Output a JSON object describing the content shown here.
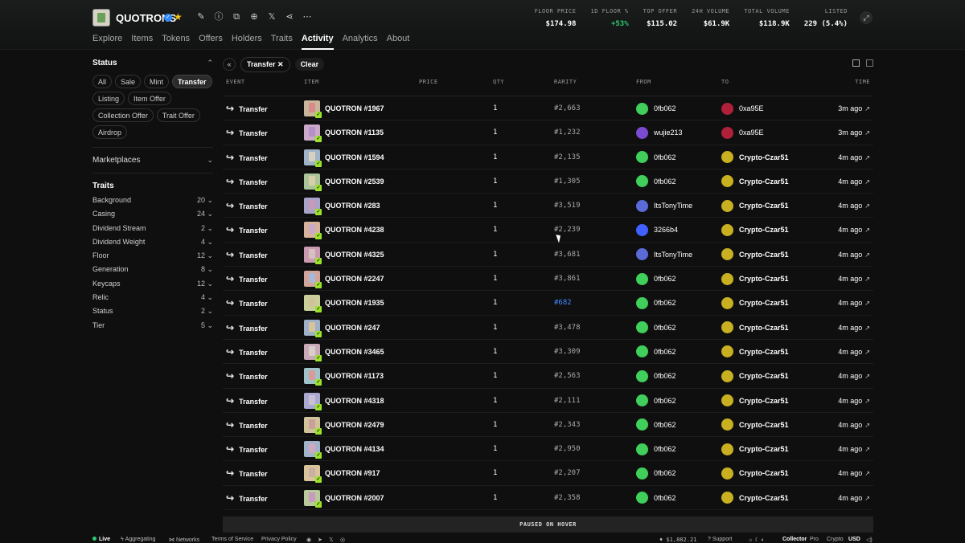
{
  "header": {
    "collection_name": "QUOTRONS",
    "icons": [
      "pencil-icon",
      "info-icon",
      "copy-icon",
      "globe-icon",
      "x-icon",
      "share-icon",
      "more-icon"
    ],
    "tabs": [
      "Explore",
      "Items",
      "Tokens",
      "Offers",
      "Holders",
      "Traits",
      "Activity",
      "Analytics",
      "About"
    ],
    "active_tab": "Activity",
    "stats": [
      {
        "label": "FLOOR PRICE",
        "value": "$174.98"
      },
      {
        "label": "1D FLOOR %",
        "value": "+53%"
      },
      {
        "label": "TOP OFFER",
        "value": "$115.02"
      },
      {
        "label": "24H VOLUME",
        "value": "$61.9K"
      },
      {
        "label": "TOTAL VOLUME",
        "value": "$118.9K"
      },
      {
        "label": "LISTED",
        "value": "229 (5.4%)"
      }
    ]
  },
  "sidebar": {
    "status_title": "Status",
    "status_chips": [
      "All",
      "Sale",
      "Mint",
      "Transfer",
      "Listing",
      "Item Offer",
      "Collection Offer",
      "Trait Offer",
      "Airdrop"
    ],
    "active_chip": "Transfer",
    "marketplaces_title": "Marketplaces",
    "traits_title": "Traits",
    "traits": [
      {
        "name": "Background",
        "count": "20"
      },
      {
        "name": "Casing",
        "count": "24"
      },
      {
        "name": "Dividend Stream",
        "count": "2"
      },
      {
        "name": "Dividend Weight",
        "count": "4"
      },
      {
        "name": "Floor",
        "count": "12"
      },
      {
        "name": "Generation",
        "count": "8"
      },
      {
        "name": "Keycaps",
        "count": "12"
      },
      {
        "name": "Relic",
        "count": "4"
      },
      {
        "name": "Status",
        "count": "2"
      },
      {
        "name": "Tier",
        "count": "5"
      }
    ]
  },
  "toolbar": {
    "filter_label": "Transfer",
    "clear_label": "Clear"
  },
  "table": {
    "columns": {
      "event": "EVENT",
      "item": "ITEM",
      "price": "PRICE",
      "qty": "QTY",
      "rarity": "RARITY",
      "from": "FROM",
      "to": "TO",
      "time": "TIME"
    },
    "rows": [
      {
        "event": "Transfer",
        "item": "QUOTRON #1967",
        "qty": "1",
        "rarity": "#2,663",
        "from": "0fb062",
        "to": "0xa95E",
        "time": "3m ago",
        "thumb": "#c9b49c",
        "body": "#d98a8a",
        "fromColor": "#3fcf5a",
        "toColor": "#b0203a"
      },
      {
        "event": "Transfer",
        "item": "QUOTRON #1135",
        "qty": "1",
        "rarity": "#1,232",
        "from": "wujie213",
        "to": "0xa95E",
        "time": "3m ago",
        "thumb": "#caa9c9",
        "body": "#b890c8",
        "fromColor": "#7a4bd0",
        "toColor": "#b0203a"
      },
      {
        "event": "Transfer",
        "item": "QUOTRON #1594",
        "qty": "1",
        "rarity": "#2,135",
        "from": "0fb062",
        "to": "Crypto-Czar51",
        "time": "4m ago",
        "thumb": "#9fb3c9",
        "body": "#d8d1c0",
        "fromColor": "#3fcf5a",
        "toColor": "#c9b020"
      },
      {
        "event": "Transfer",
        "item": "QUOTRON #2539",
        "qty": "1",
        "rarity": "#1,305",
        "from": "0fb062",
        "to": "Crypto-Czar51",
        "time": "4m ago",
        "thumb": "#a9c39a",
        "body": "#d8cfa8",
        "fromColor": "#3fcf5a",
        "toColor": "#c9b020"
      },
      {
        "event": "Transfer",
        "item": "QUOTRON #283",
        "qty": "1",
        "rarity": "#3,519",
        "from": "ItsTonyTime",
        "to": "Crypto-Czar51",
        "time": "4m ago",
        "thumb": "#a7a3c9",
        "body": "#c99ab8",
        "fromColor": "#5a6bd8",
        "toColor": "#c9b020"
      },
      {
        "event": "Transfer",
        "item": "QUOTRON #4238",
        "qty": "1",
        "rarity": "#2,239",
        "from": "3266b4",
        "to": "Crypto-Czar51",
        "time": "4m ago",
        "thumb": "#d6b39a",
        "body": "#c9a9c9",
        "fromColor": "#4060ff",
        "toColor": "#c9b020"
      },
      {
        "event": "Transfer",
        "item": "QUOTRON #4325",
        "qty": "1",
        "rarity": "#3,681",
        "from": "ItsTonyTime",
        "to": "Crypto-Czar51",
        "time": "4m ago",
        "thumb": "#c99ab0",
        "body": "#d8c0c0",
        "fromColor": "#5a6bd8",
        "toColor": "#c9b020"
      },
      {
        "event": "Transfer",
        "item": "QUOTRON #2247",
        "qty": "1",
        "rarity": "#3,861",
        "from": "0fb062",
        "to": "Crypto-Czar51",
        "time": "4m ago",
        "thumb": "#d3a49a",
        "body": "#a9b8d8",
        "fromColor": "#3fcf5a",
        "toColor": "#c9b020"
      },
      {
        "event": "Transfer",
        "item": "QUOTRON #1935",
        "qty": "1",
        "rarity": "#682",
        "rarity_hl": true,
        "from": "0fb062",
        "to": "Crypto-Czar51",
        "time": "4m ago",
        "thumb": "#c9cf9a",
        "body": "#d0c39a",
        "fromColor": "#3fcf5a",
        "toColor": "#c9b020"
      },
      {
        "event": "Transfer",
        "item": "QUOTRON #247",
        "qty": "1",
        "rarity": "#3,478",
        "from": "0fb062",
        "to": "Crypto-Czar51",
        "time": "4m ago",
        "thumb": "#9fb0c9",
        "body": "#d8c49a",
        "fromColor": "#3fcf5a",
        "toColor": "#c9b020"
      },
      {
        "event": "Transfer",
        "item": "QUOTRON #3465",
        "qty": "1",
        "rarity": "#3,309",
        "from": "0fb062",
        "to": "Crypto-Czar51",
        "time": "4m ago",
        "thumb": "#c9a9b8",
        "body": "#d8d0c8",
        "fromColor": "#3fcf5a",
        "toColor": "#c9b020"
      },
      {
        "event": "Transfer",
        "item": "QUOTRON #1173",
        "qty": "1",
        "rarity": "#2,563",
        "from": "0fb062",
        "to": "Crypto-Czar51",
        "time": "4m ago",
        "thumb": "#9fc3c9",
        "body": "#d89a9a",
        "fromColor": "#3fcf5a",
        "toColor": "#c9b020"
      },
      {
        "event": "Transfer",
        "item": "QUOTRON #4318",
        "qty": "1",
        "rarity": "#2,111",
        "from": "0fb062",
        "to": "Crypto-Czar51",
        "time": "4m ago",
        "thumb": "#a9a9d0",
        "body": "#c9c0d8",
        "fromColor": "#3fcf5a",
        "toColor": "#c9b020"
      },
      {
        "event": "Transfer",
        "item": "QUOTRON #2479",
        "qty": "1",
        "rarity": "#2,343",
        "from": "0fb062",
        "to": "Crypto-Czar51",
        "time": "4m ago",
        "thumb": "#d0c39a",
        "body": "#c9a09a",
        "fromColor": "#3fcf5a",
        "toColor": "#c9b020"
      },
      {
        "event": "Transfer",
        "item": "QUOTRON #4134",
        "qty": "1",
        "rarity": "#2,950",
        "from": "0fb062",
        "to": "Crypto-Czar51",
        "time": "4m ago",
        "thumb": "#9fb3c9",
        "body": "#d0a9c0",
        "fromColor": "#3fcf5a",
        "toColor": "#c9b020"
      },
      {
        "event": "Transfer",
        "item": "QUOTRON #917",
        "qty": "1",
        "rarity": "#2,207",
        "from": "0fb062",
        "to": "Crypto-Czar51",
        "time": "4m ago",
        "thumb": "#d8c39a",
        "body": "#c9b0a0",
        "fromColor": "#3fcf5a",
        "toColor": "#c9b020"
      },
      {
        "event": "Transfer",
        "item": "QUOTRON #2007",
        "qty": "1",
        "rarity": "#2,358",
        "from": "0fb062",
        "to": "Crypto-Czar51",
        "time": "4m ago",
        "thumb": "#b8c99a",
        "body": "#c99ac0",
        "fromColor": "#3fcf5a",
        "toColor": "#c9b020"
      }
    ]
  },
  "paused_label": "PAUSED ON HOVER",
  "footer": {
    "live": "Live",
    "aggregating": "Aggregating",
    "networks": "Networks",
    "terms": "Terms of Service",
    "privacy": "Privacy Policy",
    "price": "$1,882.21",
    "support": "Support",
    "mode": "Collector",
    "pro": "Pro",
    "crypto": "Crypto",
    "currency": "USD"
  },
  "colors": {
    "accent_green": "#2ecc71",
    "link_blue": "#3d8cff",
    "verified_blue": "#2f8bff",
    "star_gold": "#f5c518"
  }
}
